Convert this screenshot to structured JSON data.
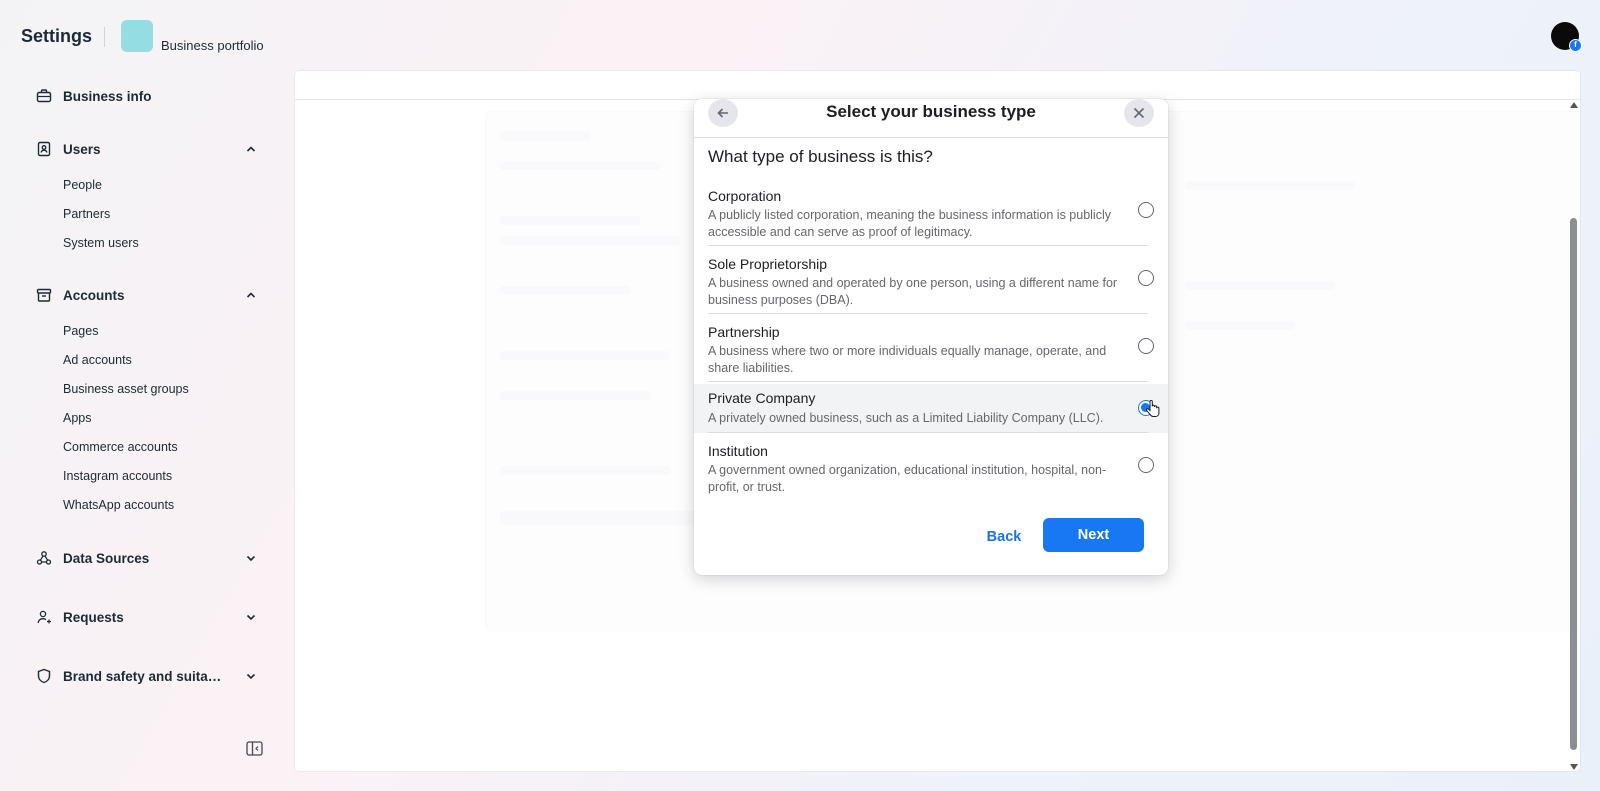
{
  "header": {
    "title": "Settings",
    "portfolio_label": "Business portfolio",
    "avatar_badge": "f"
  },
  "sidebar": {
    "business_info": "Business info",
    "users": {
      "label": "Users",
      "items": [
        "People",
        "Partners",
        "System users"
      ]
    },
    "accounts": {
      "label": "Accounts",
      "items": [
        "Pages",
        "Ad accounts",
        "Business asset groups",
        "Apps",
        "Commerce accounts",
        "Instagram accounts",
        "WhatsApp accounts"
      ]
    },
    "data_sources": "Data Sources",
    "requests": "Requests",
    "brand_safety": "Brand safety and suitabi..."
  },
  "dialog": {
    "title": "Select your business type",
    "question": "What type of business is this?",
    "options": [
      {
        "title": "Corporation",
        "description": "A publicly listed corporation, meaning the business information is publicly accessible and can serve as proof of legitimacy.",
        "selected": false
      },
      {
        "title": "Sole Proprietorship",
        "description": "A business owned and operated by one person, using a different name for business purposes (DBA).",
        "selected": false
      },
      {
        "title": "Partnership",
        "description": "A business where two or more individuals equally manage, operate, and share liabilities.",
        "selected": false
      },
      {
        "title": "Private Company",
        "description": "A privately owned business, such as a Limited Liability Company (LLC).",
        "selected": true
      },
      {
        "title": "Institution",
        "description": "A government owned organization, educational institution, hospital, non-profit, or trust.",
        "selected": false
      }
    ],
    "back_label": "Back",
    "next_label": "Next"
  },
  "colors": {
    "accent": "#1877f2",
    "portfolio_avatar": "#93dde3"
  }
}
